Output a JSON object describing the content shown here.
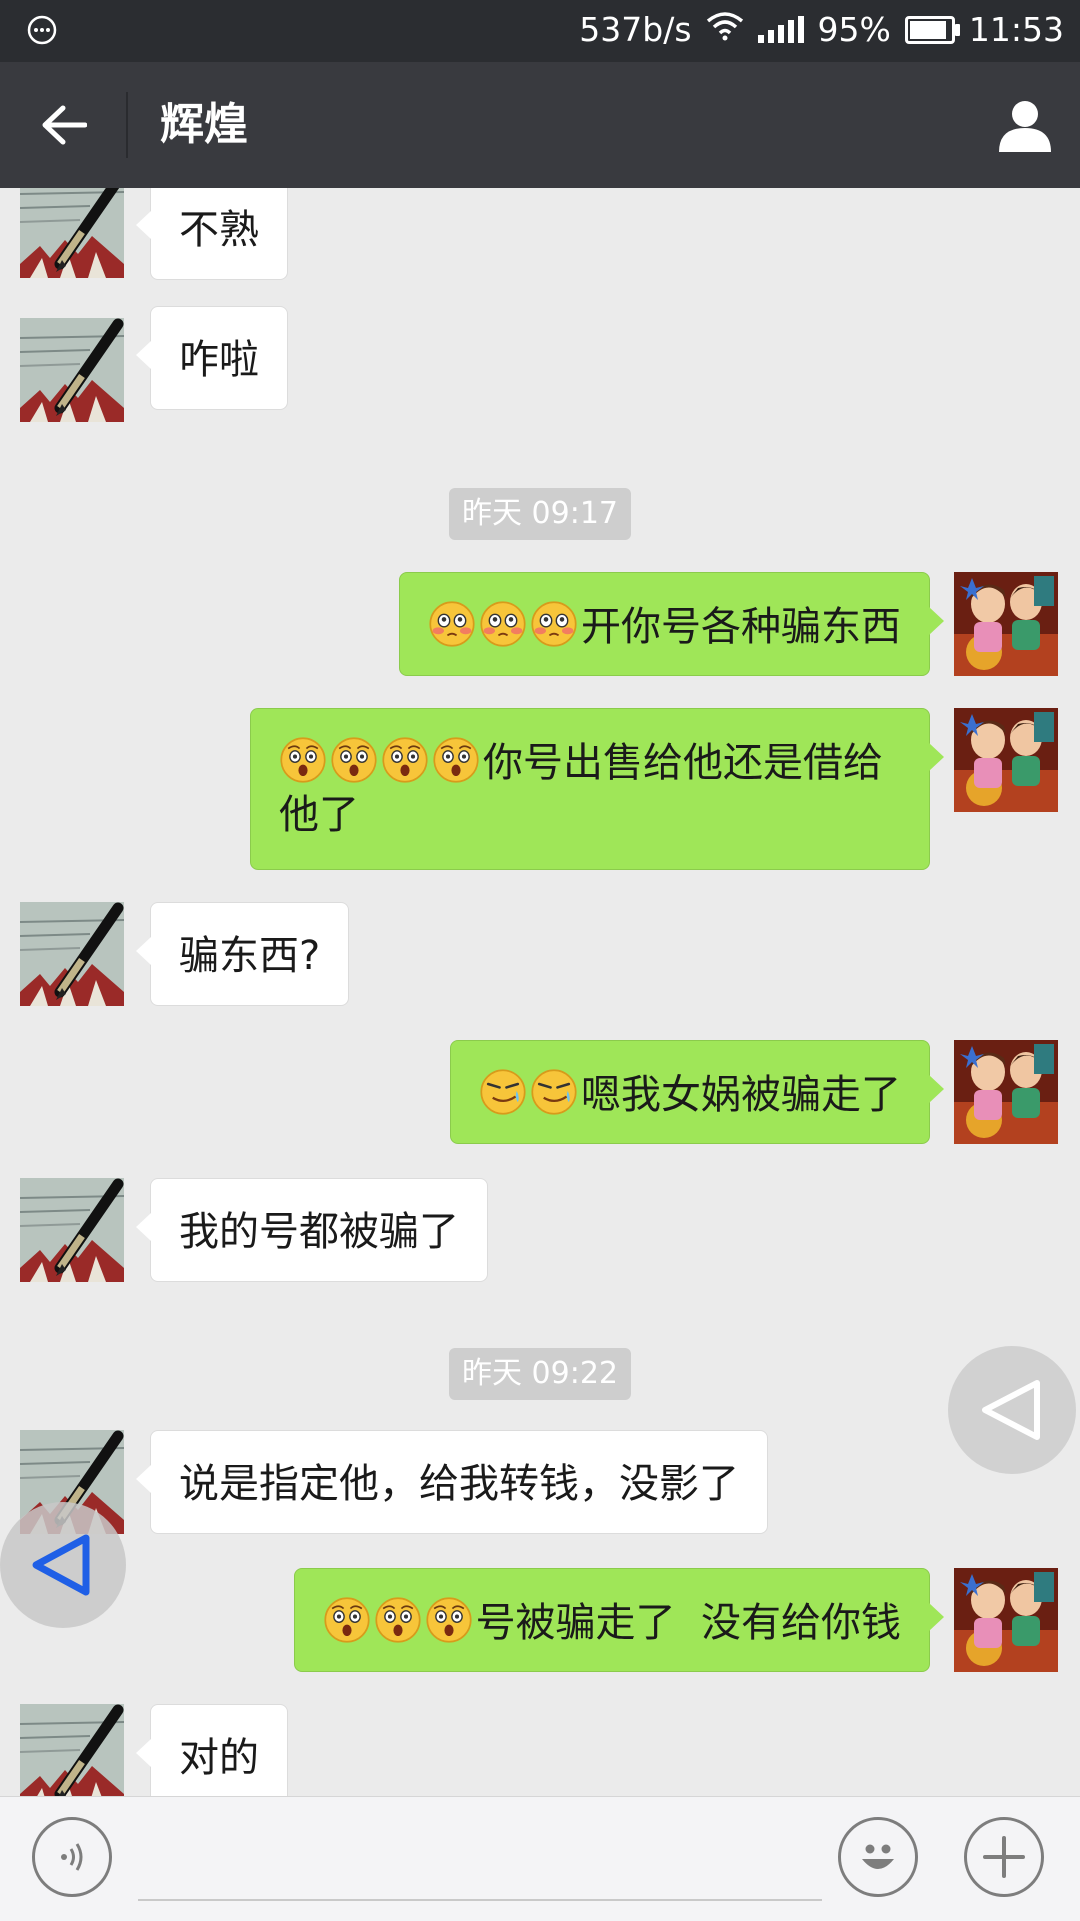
{
  "status_bar": {
    "speed": "537b/s",
    "battery": "95%",
    "battery_level": 0.95,
    "time": "11:53"
  },
  "header": {
    "title": "辉煌"
  },
  "messages": [
    {
      "side": "in",
      "text": "不熟"
    },
    {
      "side": "in",
      "text": "咋啦"
    },
    {
      "type": "time",
      "text": "昨天 09:17"
    },
    {
      "side": "out",
      "emoji": [
        "blush-emoji",
        "blush-emoji",
        "blush-emoji"
      ],
      "text": "开你号各种骗东西"
    },
    {
      "side": "out",
      "emoji": [
        "surprised-emoji",
        "surprised-emoji",
        "surprised-emoji",
        "surprised-emoji"
      ],
      "text": "你号出售给他还是借给",
      "text2": "他了"
    },
    {
      "side": "in",
      "text": "骗东西?"
    },
    {
      "side": "out",
      "emoji": [
        "smirk-emoji",
        "smirk-emoji"
      ],
      "text": "嗯我女娲被骗走了"
    },
    {
      "side": "in",
      "text": "我的号都被骗了"
    },
    {
      "type": "time",
      "text": "昨天 09:22"
    },
    {
      "side": "in",
      "text": "说是指定他，给我转钱，没影了"
    },
    {
      "side": "out",
      "emoji": [
        "surprised-emoji",
        "surprised-emoji",
        "surprised-emoji"
      ],
      "text": "号被骗走了  没有给你钱"
    },
    {
      "side": "in",
      "text": "对的"
    }
  ],
  "colors": {
    "outgoing_bubble": "#9fe658",
    "incoming_bubble": "#ffffff",
    "title_bar": "#393a3f",
    "status_bar": "#2b2d31"
  }
}
